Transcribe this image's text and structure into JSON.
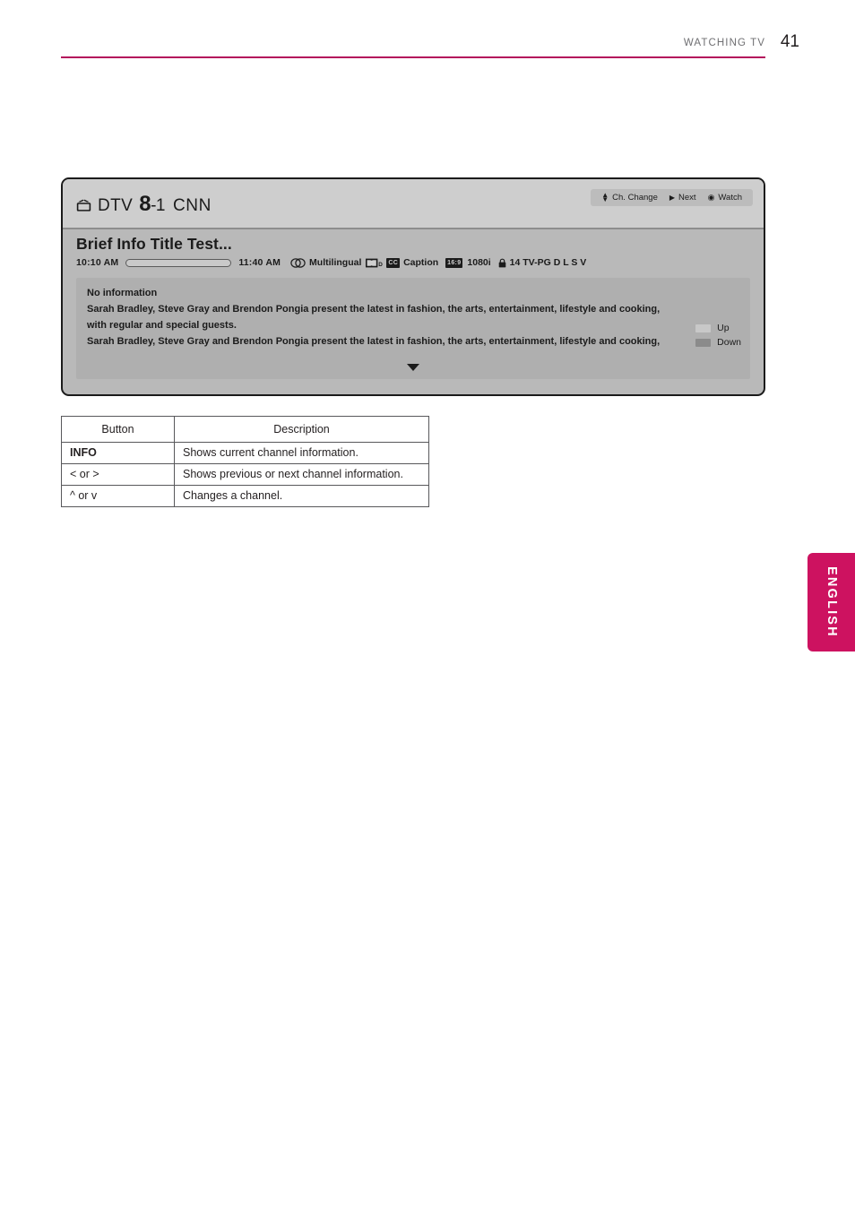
{
  "header": {
    "section": "WATCHING TV",
    "page_number": "41",
    "rule_color": "#b4115c"
  },
  "osd": {
    "tv_icon": "tv-icon",
    "source": "DTV",
    "channel_number": "8",
    "channel_separator": "-1",
    "channel_name": "CNN",
    "nav": [
      {
        "icon": "up-down-arrows-icon",
        "glyph": "⌃⌄",
        "label": "Ch. Change"
      },
      {
        "icon": "play-triangle-icon",
        "glyph": "▶",
        "label": "Next"
      },
      {
        "icon": "record-dot-icon",
        "glyph": "◉",
        "label": "Watch"
      }
    ],
    "program_title": "Brief Info Title Test...",
    "start_time": "10:10 AM",
    "end_time": "11:40 AM",
    "progress_percent": 11,
    "audio_label": "Multilingual",
    "caption_label": "Caption",
    "dolby_badge": "D",
    "cc_badge": "CC",
    "aspect_badge": "16:9",
    "resolution": "1080i",
    "rating": "14 TV-PG D L S V",
    "description_lines": [
      "No information",
      "Sarah Bradley, Steve Gray and Brendon Pongia present the latest in fashion, the arts, entertainment, lifestyle and cooking,",
      "with regular and special guests.",
      "Sarah Bradley, Steve Gray and Brendon Pongia present the latest in fashion, the arts, entertainment, lifestyle and cooking,"
    ],
    "scroll_legend": [
      {
        "label": "Up"
      },
      {
        "label": "Down"
      }
    ],
    "more_arrow": "chevron-down-icon",
    "colors": {
      "panel_border": "#1b1b1b",
      "titlebar_bg": "#cecece",
      "body_bg": "#b9b9b9",
      "desc_bg": "#afafaf"
    }
  },
  "key_table": {
    "headers": [
      "Button",
      "Description"
    ],
    "rows": [
      {
        "key": "INFO",
        "key_bold": "INFO",
        "desc": "Shows current channel information."
      },
      {
        "key": "< or >",
        "desc": "Shows previous or next channel information."
      },
      {
        "key": "^ or v",
        "desc": "Changes a channel."
      }
    ]
  },
  "language_tab": {
    "label": "ENGLISH",
    "color": "#cd1260"
  }
}
